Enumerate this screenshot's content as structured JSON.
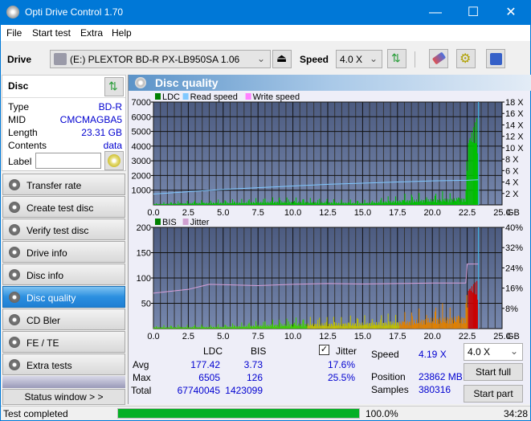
{
  "window": {
    "title": "Opti Drive Control 1.70",
    "minimize": "—",
    "maximize": "☐",
    "close": "✕"
  },
  "menu": [
    "File",
    "Start test",
    "Extra",
    "Help"
  ],
  "toolbar": {
    "drive_label": "Drive",
    "drive_value": "(E:)  PLEXTOR BD-R  PX-LB950SA 1.06",
    "speed_label": "Speed",
    "speed_value": "4.0 X"
  },
  "disc": {
    "header": "Disc",
    "rows": [
      {
        "k": "Type",
        "v": "BD-R"
      },
      {
        "k": "MID",
        "v": "CMCMAGBA5"
      },
      {
        "k": "Length",
        "v": "23.31 GB"
      },
      {
        "k": "Contents",
        "v": "data"
      }
    ],
    "label_label": "Label",
    "label_value": ""
  },
  "nav": [
    {
      "label": "Transfer rate",
      "active": false
    },
    {
      "label": "Create test disc",
      "active": false
    },
    {
      "label": "Verify test disc",
      "active": false
    },
    {
      "label": "Drive info",
      "active": false
    },
    {
      "label": "Disc info",
      "active": false
    },
    {
      "label": "Disc quality",
      "active": true
    },
    {
      "label": "CD Bler",
      "active": false
    },
    {
      "label": "FE / TE",
      "active": false
    },
    {
      "label": "Extra tests",
      "active": false
    }
  ],
  "status_window_label": "Status window > >",
  "panel_title": "Disc quality",
  "chart_data": [
    {
      "type": "bar",
      "title": "LDC",
      "legend": [
        "LDC",
        "Read speed",
        "Write speed"
      ],
      "legend_colors": [
        "#008000",
        "#80c8ff",
        "#ff80ff"
      ],
      "xlabel": "GB",
      "xlim": [
        0,
        25
      ],
      "ylim": [
        0,
        7000
      ],
      "y2lim": [
        0,
        18
      ],
      "x_ticks": [
        "0.0",
        "2.5",
        "5.0",
        "7.5",
        "10.0",
        "12.5",
        "15.0",
        "17.5",
        "20.0",
        "22.5",
        "25.0"
      ],
      "y_ticks": [
        "1000",
        "2000",
        "3000",
        "4000",
        "5000",
        "6000",
        "7000"
      ],
      "y2_ticks": [
        "2 X",
        "4 X",
        "6 X",
        "8 X",
        "10 X",
        "12 X",
        "14 X",
        "16 X",
        "18 X"
      ],
      "ldc_profile": [
        [
          0,
          60
        ],
        [
          3,
          150
        ],
        [
          6,
          180
        ],
        [
          9,
          250
        ],
        [
          12,
          200
        ],
        [
          15,
          150
        ],
        [
          18,
          350
        ],
        [
          20,
          400
        ],
        [
          22.4,
          500
        ],
        [
          22.5,
          5000
        ],
        [
          23.2,
          6000
        ],
        [
          23.31,
          500
        ]
      ],
      "read_speed": [
        [
          0,
          1.9
        ],
        [
          2.5,
          2.3
        ],
        [
          5,
          2.7
        ],
        [
          7.5,
          3.0
        ],
        [
          10,
          3.3
        ],
        [
          12.5,
          3.6
        ],
        [
          15,
          3.8
        ],
        [
          17.5,
          4.0
        ],
        [
          20,
          4.2
        ],
        [
          22.5,
          4.3
        ],
        [
          23.31,
          4.4
        ]
      ],
      "end_marker": 23.31
    },
    {
      "type": "bar",
      "title": "BIS",
      "legend": [
        "BIS",
        "Jitter"
      ],
      "legend_colors": [
        "#008000",
        "#d0a0d0"
      ],
      "xlabel": "GB",
      "xlim": [
        0,
        25
      ],
      "ylim": [
        0,
        200
      ],
      "y2lim": [
        0,
        40
      ],
      "x_ticks": [
        "0.0",
        "2.5",
        "5.0",
        "7.5",
        "10.0",
        "12.5",
        "15.0",
        "17.5",
        "20.0",
        "22.5",
        "25.0"
      ],
      "y_ticks": [
        "50",
        "100",
        "150",
        "200"
      ],
      "y2_ticks": [
        "8%",
        "16%",
        "24%",
        "32%",
        "40%"
      ],
      "bis_profile": [
        [
          0,
          3
        ],
        [
          5,
          4
        ],
        [
          10,
          10
        ],
        [
          15,
          12
        ],
        [
          18,
          15
        ],
        [
          20,
          22
        ],
        [
          22.4,
          25
        ],
        [
          22.5,
          90
        ],
        [
          23.2,
          95
        ],
        [
          23.31,
          20
        ]
      ],
      "jitter": [
        [
          0,
          14
        ],
        [
          2.5,
          15.5
        ],
        [
          4,
          17.5
        ],
        [
          7.5,
          17
        ],
        [
          10,
          17.5
        ],
        [
          12.5,
          17.8
        ],
        [
          15,
          17.6
        ],
        [
          17.5,
          17.8
        ],
        [
          20,
          18
        ],
        [
          22.4,
          18
        ],
        [
          22.5,
          25.5
        ],
        [
          23.31,
          25.5
        ]
      ],
      "end_marker": 23.31
    }
  ],
  "stats": {
    "col_ldc": "LDC",
    "col_bis": "BIS",
    "jitter_label": "Jitter",
    "jitter_checked": true,
    "avg_label": "Avg",
    "avg_ldc": "177.42",
    "avg_bis": "3.73",
    "avg_jitter": "17.6%",
    "max_label": "Max",
    "max_ldc": "6505",
    "max_bis": "126",
    "max_jitter": "25.5%",
    "total_label": "Total",
    "total_ldc": "67740045",
    "total_bis": "1423099"
  },
  "info": {
    "speed_label": "Speed",
    "speed_value": "4.19 X",
    "position_label": "Position",
    "position_value": "23862 MB",
    "samples_label": "Samples",
    "samples_value": "380316",
    "speed_select": "4.0 X",
    "start_full": "Start full",
    "start_part": "Start part"
  },
  "statusbar": {
    "text": "Test completed",
    "progress": 100.0,
    "progress_text": "100.0%",
    "time": "34:28"
  }
}
